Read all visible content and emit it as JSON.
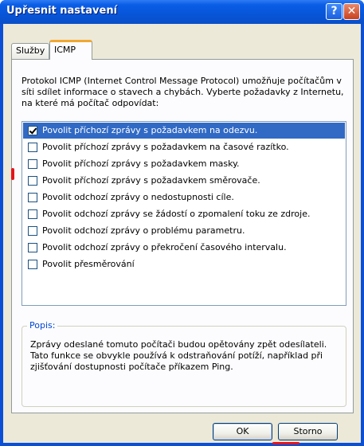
{
  "window": {
    "title": "Upřesnit nastavení",
    "help_glyph": "?",
    "close_glyph": "✕"
  },
  "tabs": [
    {
      "label": "Služby",
      "active": false
    },
    {
      "label": "ICMP",
      "active": true
    }
  ],
  "intro_text": "Protokol ICMP (Internet Control Message Protocol) umožňuje počítačům v síti sdílet informace o stavech a chybách. Vyberte požadavky z Internetu, na které má počítač odpovídat:",
  "options": [
    {
      "label": "Povolit příchozí zprávy s požadavkem na odezvu.",
      "checked": true,
      "selected": true
    },
    {
      "label": "Povolit příchozí zprávy s požadavkem na časové razítko.",
      "checked": false,
      "selected": false
    },
    {
      "label": "Povolit příchozí zprávy s požadavkem masky.",
      "checked": false,
      "selected": false
    },
    {
      "label": "Povolit příchozí zprávy s požadavkem směrovače.",
      "checked": false,
      "selected": false
    },
    {
      "label": "Povolit odchozí zprávy o nedostupnosti cíle.",
      "checked": false,
      "selected": false
    },
    {
      "label": "Povolit odchozí zprávy se žádostí o zpomalení toku ze zdroje.",
      "checked": false,
      "selected": false
    },
    {
      "label": "Povolit odchozí zprávy o problému parametru.",
      "checked": false,
      "selected": false
    },
    {
      "label": "Povolit odchozí zprávy o překročení časového intervalu.",
      "checked": false,
      "selected": false
    },
    {
      "label": "Povolit přesměrování",
      "checked": false,
      "selected": false
    }
  ],
  "description": {
    "legend": "Popis:",
    "text": "Zprávy odeslané tomuto počítači budou opětovány zpět odesílateli. Tato funkce se obvykle používá k odstraňování potíží, například při zjišťování dostupnosti počítače příkazem Ping."
  },
  "buttons": {
    "ok": "OK",
    "cancel": "Storno"
  },
  "colors": {
    "titlebar": "#0a5de6",
    "selection": "#316ac5",
    "highlight_marker": "#e4141b",
    "group_legend": "#0046d5"
  }
}
